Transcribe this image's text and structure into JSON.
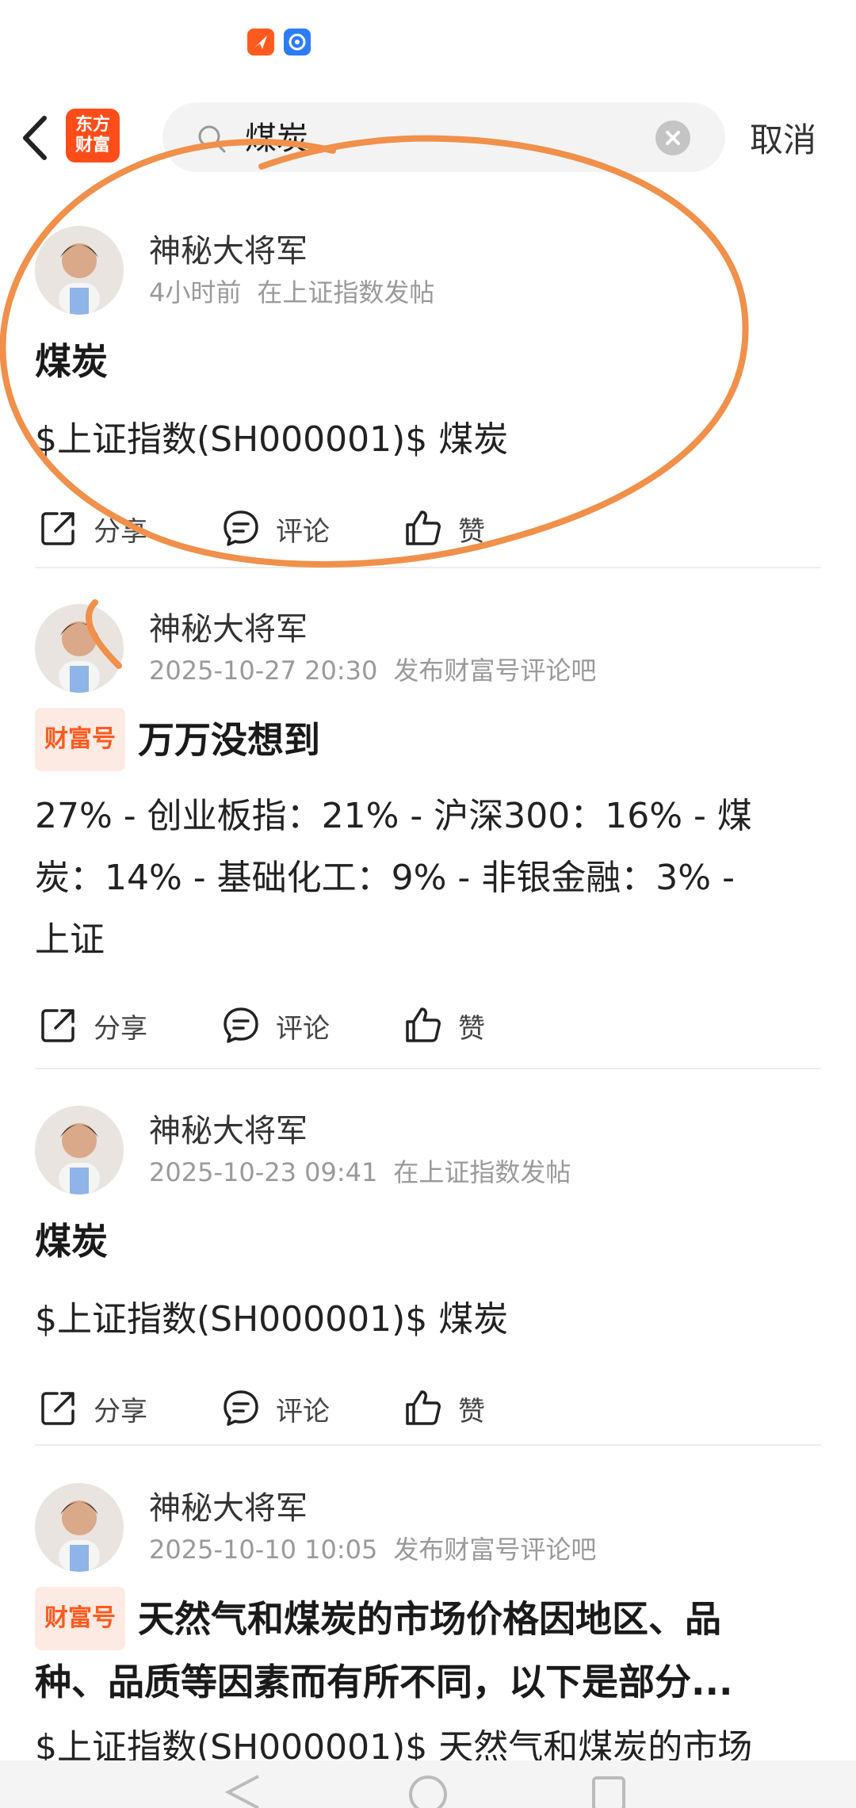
{
  "status_bar": {
    "icons": [
      "app-icon-orange",
      "app-icon-blue"
    ]
  },
  "header": {
    "logo_line1": "东方",
    "logo_line2": "财富",
    "search_value": "煤炭",
    "cancel_label": "取消"
  },
  "posts": [
    {
      "author": "神秘大将军",
      "time": "4小时前",
      "source": "在上证指数发帖",
      "badge": "",
      "title": "煤炭",
      "body": "$上证指数(SH000001)$ 煤炭"
    },
    {
      "author": "神秘大将军",
      "time": "2025-10-27 20:30",
      "source": "发布财富号评论吧",
      "badge": "财富号",
      "title": "万万没想到",
      "body_lines": [
        "27% - 创业板指：21% - 沪深300：16% - 煤",
        "炭：14% - 基础化工：9% - 非银金融：3% -",
        "上证"
      ]
    },
    {
      "author": "神秘大将军",
      "time": "2025-10-23 09:41",
      "source": "在上证指数发帖",
      "badge": "",
      "title": "煤炭",
      "body": "$上证指数(SH000001)$ 煤炭"
    },
    {
      "author": "神秘大将军",
      "time": "2025-10-10 10:05",
      "source": "发布财富号评论吧",
      "badge": "财富号",
      "title_lines": [
        "天然气和煤炭的市场价格因地区、品",
        "种、品质等因素而有所不同，以下是部分..."
      ],
      "body": "$上证指数(SH000001)$ 天然气和煤炭的市场"
    }
  ],
  "actions": {
    "share": "分享",
    "comment": "评论",
    "like": "赞"
  },
  "colors": {
    "accent": "#ff5a1f",
    "annotation": "#f0904a"
  }
}
